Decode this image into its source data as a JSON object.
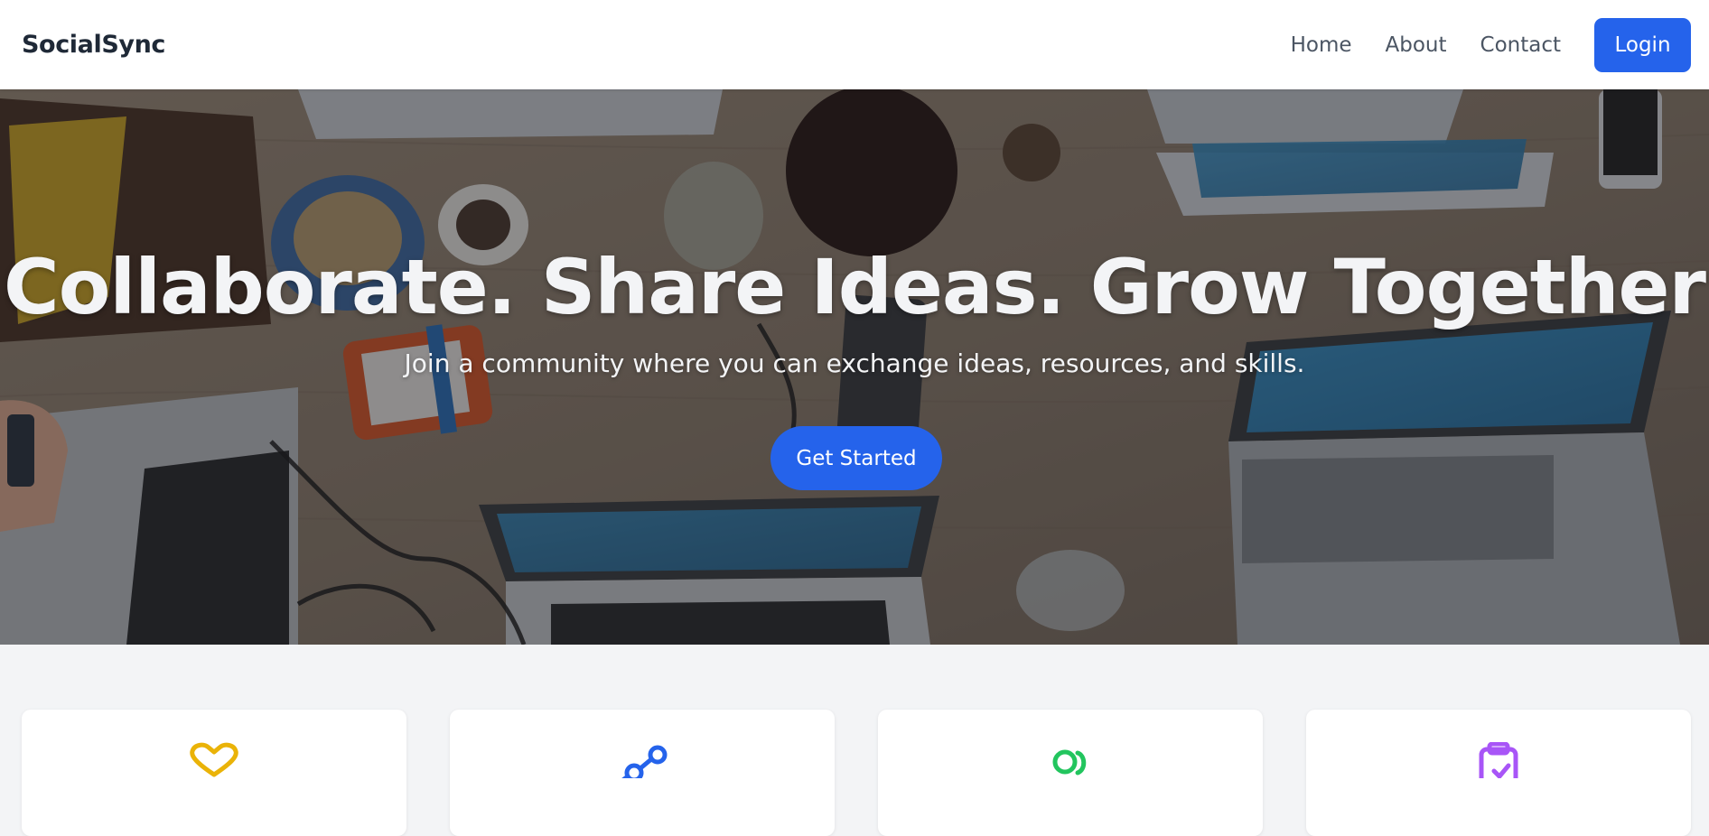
{
  "navbar": {
    "brand": "SocialSync",
    "links": [
      {
        "label": "Home"
      },
      {
        "label": "About"
      },
      {
        "label": "Contact"
      }
    ],
    "login_label": "Login"
  },
  "hero": {
    "title": "Collaborate. Share Ideas. Grow Together",
    "subtitle": "Join a community where you can exchange ideas, resources, and skills.",
    "cta_label": "Get Started"
  },
  "features": {
    "cards": [
      {
        "icon": "heart-icon",
        "color": "#eab308"
      },
      {
        "icon": "share-icon",
        "color": "#2563eb"
      },
      {
        "icon": "connect-icon",
        "color": "#22c55e"
      },
      {
        "icon": "clipboard-icon",
        "color": "#a855f7"
      }
    ]
  },
  "colors": {
    "primary": "#2563eb",
    "page_background": "#f3f4f6",
    "brand_text": "#1f2937",
    "nav_text": "#4b5563"
  }
}
